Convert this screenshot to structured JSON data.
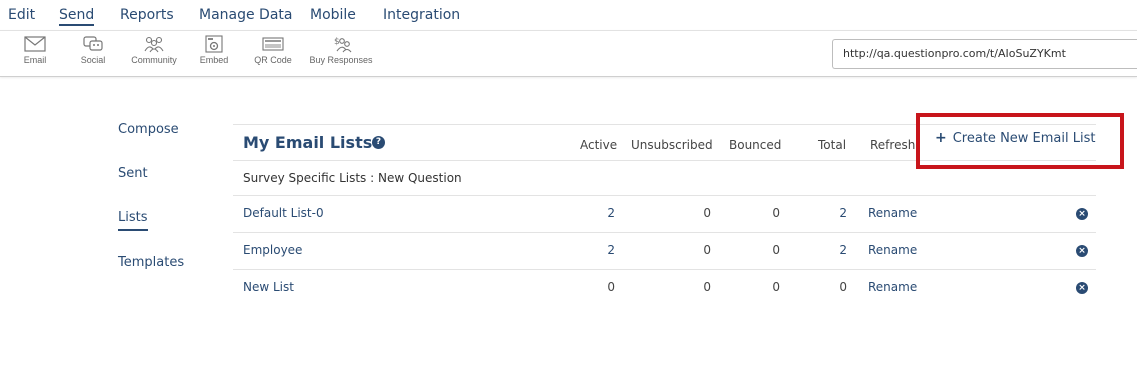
{
  "topnav": {
    "edit": "Edit",
    "send": "Send",
    "reports": "Reports",
    "manage_data": "Manage Data",
    "mobile": "Mobile",
    "integration": "Integration"
  },
  "toolbar": {
    "email": "Email",
    "social": "Social",
    "community": "Community",
    "embed": "Embed",
    "qr_code": "QR Code",
    "buy_responses": "Buy Responses"
  },
  "survey_url": "http://qa.questionpro.com/t/AIoSuZYKmt",
  "subnav": {
    "compose": "Compose",
    "sent": "Sent",
    "lists": "Lists",
    "templates": "Templates"
  },
  "table": {
    "title": "My Email Lists",
    "help_icon": "?",
    "columns": {
      "active": "Active",
      "unsubscribed": "Unsubscribed",
      "bounced": "Bounced",
      "total": "Total",
      "refresh": "Refresh"
    },
    "section_label": "Survey Specific Lists : New Question",
    "rename_label": "Rename",
    "delete_glyph": "×",
    "rows": [
      {
        "name": "Default List-0",
        "active": "2",
        "unsubscribed": "0",
        "bounced": "0",
        "total": "2"
      },
      {
        "name": "Employee",
        "active": "2",
        "unsubscribed": "0",
        "bounced": "0",
        "total": "2"
      },
      {
        "name": "New List",
        "active": "0",
        "unsubscribed": "0",
        "bounced": "0",
        "total": "0"
      }
    ]
  },
  "create_button": {
    "plus": "+",
    "label": "Create New Email List"
  },
  "colors": {
    "primary": "#2a4b73",
    "highlight": "#c8151b"
  }
}
